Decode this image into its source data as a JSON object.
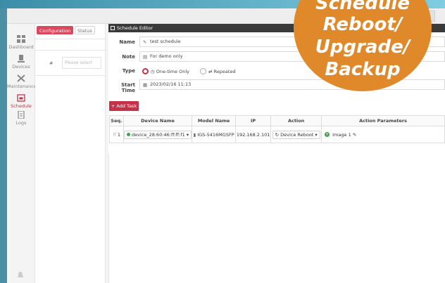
{
  "sidebar": {
    "items": [
      {
        "label": "Dashboard",
        "icon": "dashboard-icon"
      },
      {
        "label": "Devices",
        "icon": "devices-icon"
      },
      {
        "label": "Maintenance",
        "icon": "maintenance-icon"
      },
      {
        "label": "Schedule",
        "icon": "schedule-icon",
        "active": true
      },
      {
        "label": "Logs",
        "icon": "logs-icon"
      }
    ]
  },
  "list_panel": {
    "tabs": [
      {
        "label": "Configuration",
        "active": true
      },
      {
        "label": "Status",
        "active": false
      }
    ],
    "row_hash": "#",
    "select_placeholder": "Please select"
  },
  "editor": {
    "title": "Schedule Editor",
    "name_label": "Name",
    "name_value": "test schedule",
    "note_label": "Note",
    "note_value": "For demo only",
    "type_label": "Type",
    "type_options": [
      "One-time Only",
      "Repeated"
    ],
    "type_selected": "One-time Only",
    "start_label": "Start Time",
    "start_value": "2023/02/16 11:13",
    "add_task_label": "+ Add Task",
    "columns": [
      "Seq.",
      "Device Name",
      "Model Name",
      "IP",
      "Action",
      "Action Parameters"
    ],
    "rows": [
      {
        "seq": "1",
        "device": "device_28:60:46:ff:ff:f1",
        "model": "IGS-5416MGSFP",
        "ip": "192.168.2.101",
        "action": "Device Reboot",
        "param": "Image 1"
      }
    ]
  },
  "badge": {
    "lines": [
      "Schedule",
      "Reboot/",
      "Upgrade/",
      "Backup"
    ]
  },
  "colors": {
    "accent": "#c4324a",
    "badge": "#e0892b",
    "status_ok": "#3aa64a"
  }
}
